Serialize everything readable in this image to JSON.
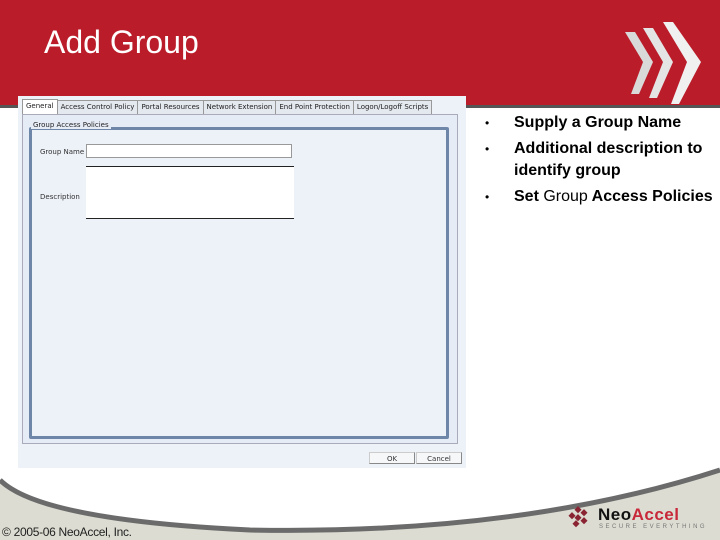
{
  "slide": {
    "title": "Add Group",
    "bullets": [
      {
        "parts": [
          {
            "text": "Supply a Group Name",
            "bold": true
          }
        ]
      },
      {
        "parts": [
          {
            "text": "Additional description to identify group",
            "bold": true
          }
        ]
      },
      {
        "parts": [
          {
            "text": "Set ",
            "bold": true
          },
          {
            "text": "Group",
            "bold": false
          },
          {
            "text": " Access Policies",
            "bold": true
          }
        ]
      }
    ],
    "bullet_char": "•",
    "copyright": "© 2005-06 NeoAccel, Inc.",
    "colors": {
      "header": "#bb1c2a",
      "brand_accent": "#c8283a"
    }
  },
  "dialog": {
    "tabs": [
      {
        "label": "General",
        "active": true
      },
      {
        "label": "Access Control Policy",
        "active": false
      },
      {
        "label": "Portal Resources",
        "active": false
      },
      {
        "label": "Network Extension",
        "active": false
      },
      {
        "label": "End Point Protection",
        "active": false
      },
      {
        "label": "Logon/Logoff Scripts",
        "active": false
      }
    ],
    "group_box_label": "Group Access Policies",
    "fields": {
      "group_name_label": "Group Name",
      "group_name_value": "",
      "description_label": "Description",
      "description_value": ""
    },
    "buttons": {
      "ok": "OK",
      "cancel": "Cancel"
    }
  },
  "logo": {
    "name_part1": "Neo",
    "name_part2": "Accel",
    "tagline": "SECURE EVERYTHING",
    "icon": "neoaccel-cube-logo-icon"
  }
}
